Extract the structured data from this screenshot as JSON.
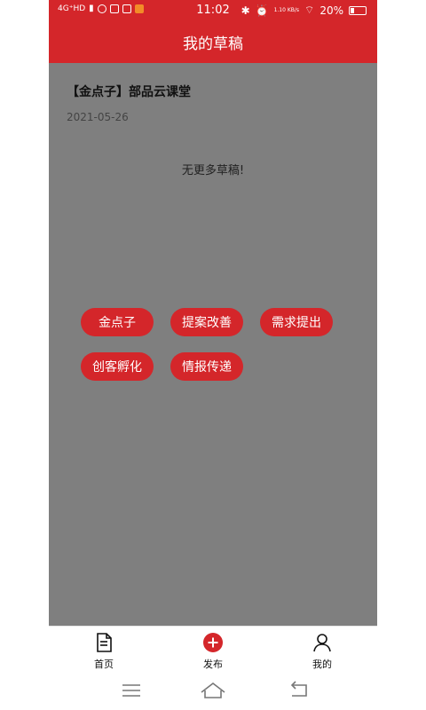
{
  "status_bar": {
    "network": "4G⁺HD",
    "time": "11:02",
    "speed": "1.10 KB/s",
    "battery": "20%"
  },
  "header": {
    "title": "我的草稿"
  },
  "drafts": [
    {
      "title": "【金点子】部品云课堂",
      "date": "2021-05-26"
    }
  ],
  "empty_text": "无更多草稿!",
  "publish_menu": {
    "options": [
      {
        "label": "金点子"
      },
      {
        "label": "提案改善"
      },
      {
        "label": "需求提出"
      },
      {
        "label": "创客孵化"
      },
      {
        "label": "情报传递"
      }
    ]
  },
  "tabbar": {
    "items": [
      {
        "label": "首页",
        "icon": "document-icon"
      },
      {
        "label": "发布",
        "icon": "plus-circle-icon"
      },
      {
        "label": "我的",
        "icon": "user-icon"
      }
    ]
  },
  "colors": {
    "accent": "#d4262a",
    "overlay": "#7f7f7f"
  }
}
